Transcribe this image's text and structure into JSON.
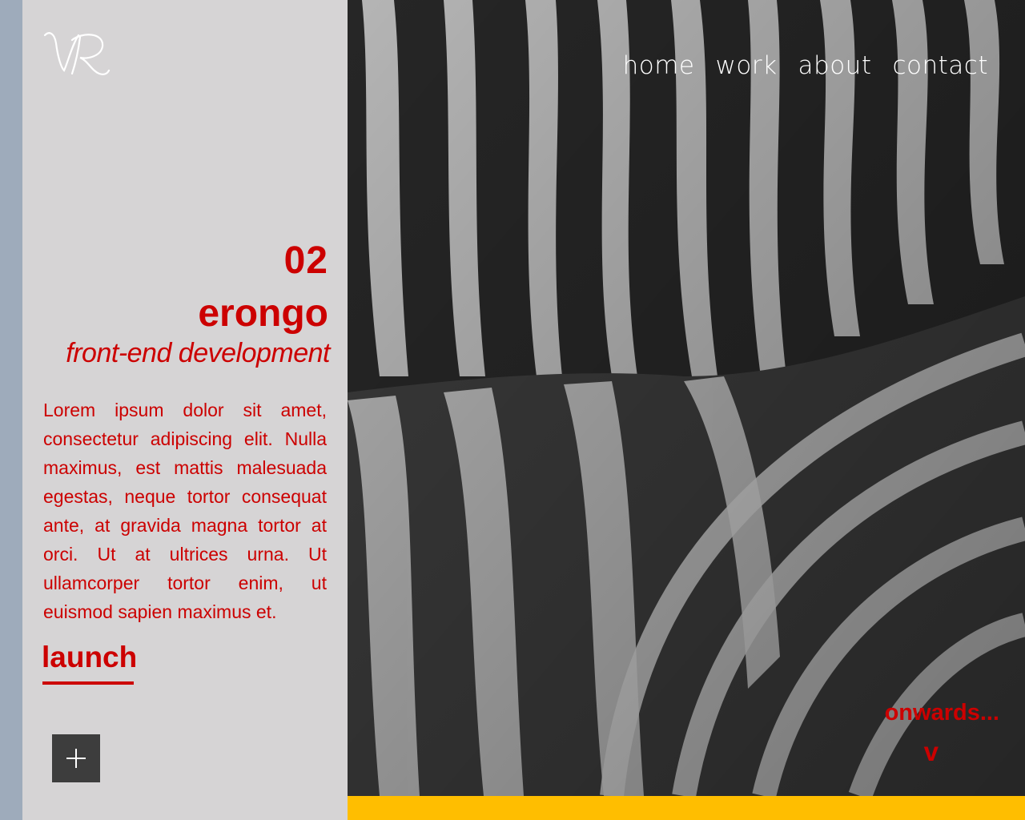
{
  "logo": {
    "icon": "vr-monogram-logo"
  },
  "nav": {
    "items": [
      "home",
      "work",
      "about",
      "contact"
    ]
  },
  "project": {
    "number": "02",
    "title": "erongo",
    "subtitle": "front-end development",
    "description": "Lorem ipsum dolor sit amet, consectetur adipiscing elit. Nulla maximus, est mattis malesuada egestas, neque tortor consequat ante, at gravida magna tortor at orci. Ut at ultrices urna. Ut ullamcorper tortor enim, ut euismod sapien maximus et.",
    "launch_label": "launch"
  },
  "plus_button": {
    "icon": "plus-icon"
  },
  "onwards": {
    "label": "onwards...",
    "arrow": "v"
  },
  "colors": {
    "accent": "#cc0000",
    "panel": "#d6d4d5",
    "strip": "#9eabbb",
    "bar": "#ffbe00",
    "button": "#3d3d3d"
  },
  "hero_image": {
    "subject": "zebra-stripes-photo"
  }
}
